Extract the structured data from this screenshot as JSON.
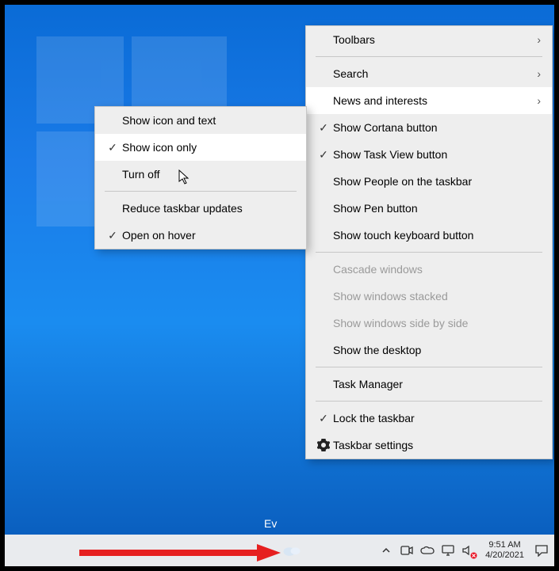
{
  "desktop": {
    "ev_label": "Ev"
  },
  "main_menu": {
    "items": [
      {
        "label": "Toolbars",
        "arrow": true
      },
      {
        "sep": true
      },
      {
        "label": "Search",
        "arrow": true
      },
      {
        "label": "News and interests",
        "arrow": true,
        "hover": true
      },
      {
        "label": "Show Cortana button",
        "check": true
      },
      {
        "label": "Show Task View button",
        "check": true
      },
      {
        "label": "Show People on the taskbar"
      },
      {
        "label": "Show Pen button"
      },
      {
        "label": "Show touch keyboard button"
      },
      {
        "sep": true
      },
      {
        "label": "Cascade windows",
        "disabled": true
      },
      {
        "label": "Show windows stacked",
        "disabled": true
      },
      {
        "label": "Show windows side by side",
        "disabled": true
      },
      {
        "label": "Show the desktop"
      },
      {
        "sep": true
      },
      {
        "label": "Task Manager"
      },
      {
        "sep": true
      },
      {
        "label": "Lock the taskbar",
        "check": true
      },
      {
        "label": "Taskbar settings",
        "gear": true
      }
    ]
  },
  "sub_menu": {
    "items": [
      {
        "label": "Show icon and text"
      },
      {
        "label": "Show icon only",
        "check": true,
        "hover": true
      },
      {
        "label": "Turn off"
      },
      {
        "sep": true
      },
      {
        "label": "Reduce taskbar updates"
      },
      {
        "label": "Open on hover",
        "check": true
      }
    ]
  },
  "taskbar": {
    "time": "9:51 AM",
    "date": "4/20/2021"
  }
}
